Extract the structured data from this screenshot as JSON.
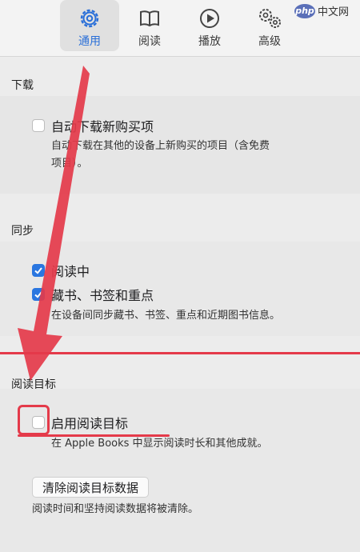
{
  "toolbar": {
    "tabs": [
      {
        "label": "通用",
        "icon": "gear-icon",
        "active": true
      },
      {
        "label": "阅读",
        "icon": "book-icon",
        "active": false
      },
      {
        "label": "播放",
        "icon": "play-icon",
        "active": false
      },
      {
        "label": "高级",
        "icon": "gears-icon",
        "active": false
      }
    ]
  },
  "watermark": {
    "logo": "php",
    "text": "中文网"
  },
  "download": {
    "title": "下载",
    "auto_download_label": "自动下载新购买项",
    "auto_download_checked": false,
    "desc_line1": "自动下载在其他的设备上新购买的项目（含免费",
    "desc_line2": "项目）。"
  },
  "sync": {
    "title": "同步",
    "reading_now_label": "阅读中",
    "reading_now_checked": true,
    "collections_label": "藏书、书签和重点",
    "collections_checked": true,
    "desc": "在设备间同步藏书、书签、重点和近期图书信息。"
  },
  "reading_goals": {
    "title": "阅读目标",
    "enable_label": "启用阅读目标",
    "enable_checked": false,
    "enable_desc": "在 Apple Books 中显示阅读时长和其他成就。",
    "clear_button": "清除阅读目标数据",
    "clear_desc": "阅读时间和坚持阅读数据将被清除。"
  },
  "colors": {
    "accent": "#2a6fd8",
    "annotation": "#e43a4a"
  }
}
